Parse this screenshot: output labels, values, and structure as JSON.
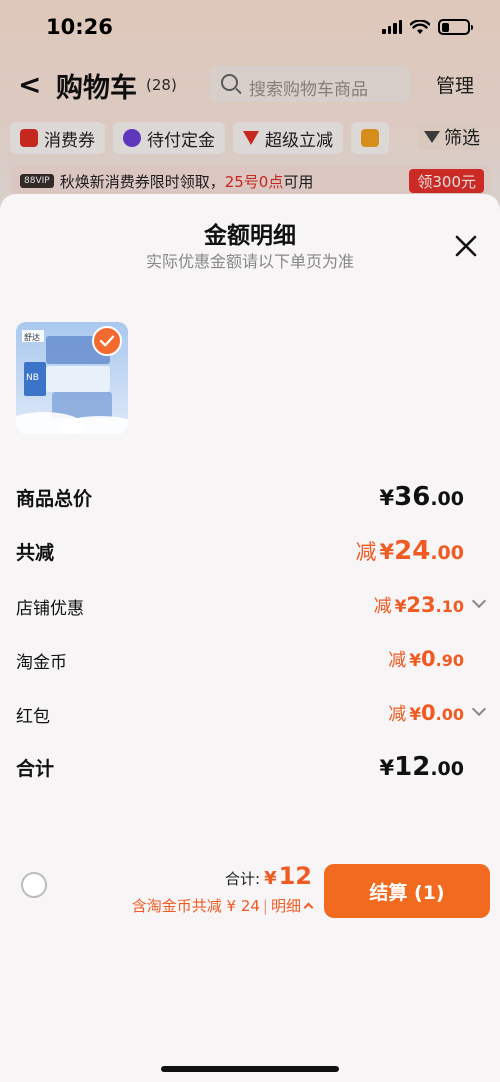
{
  "status": {
    "time": "10:26"
  },
  "background": {
    "title": "购物车",
    "count": "(28)",
    "search_placeholder": "搜索购物车商品",
    "manage": "管理",
    "chips": [
      "消费券",
      "待付定金",
      "超级立减"
    ],
    "filter": "筛选",
    "banner": {
      "vip": "88VIP",
      "text_prefix": "秋焕新消费券限时领取，",
      "text_red": "25号0点",
      "text_suffix": "可用",
      "button": "领300元"
    }
  },
  "sheet": {
    "title": "金额明细",
    "subtitle": "实际优惠金额请以下单页为准",
    "product_badge": "NB",
    "product_brand": "舒达",
    "rows": [
      {
        "label": "商品总价",
        "prefix": "",
        "currency": "¥",
        "integer": "36",
        "decimal": ".00"
      },
      {
        "label": "共减",
        "prefix": "减",
        "currency": "¥",
        "integer": "24",
        "decimal": ".00"
      },
      {
        "label": "店铺优惠",
        "prefix": "减",
        "currency": "¥",
        "integer": "23",
        "decimal": ".10"
      },
      {
        "label": "淘金币",
        "prefix": "减",
        "currency": "¥",
        "integer": "0",
        "decimal": ".90"
      },
      {
        "label": "红包",
        "prefix": "减",
        "currency": "¥",
        "integer": "0",
        "decimal": ".00"
      },
      {
        "label": "合计",
        "prefix": "",
        "currency": "¥",
        "integer": "12",
        "decimal": ".00"
      }
    ]
  },
  "bottom": {
    "total_label": "合计:",
    "total_currency": "¥",
    "total_value": "12",
    "coin_text": "含淘金币共减 ¥ 24",
    "detail": "明细",
    "checkout": "结算 (1)"
  },
  "colors": {
    "accent": "#f05a23",
    "button": "#f26a1f"
  }
}
